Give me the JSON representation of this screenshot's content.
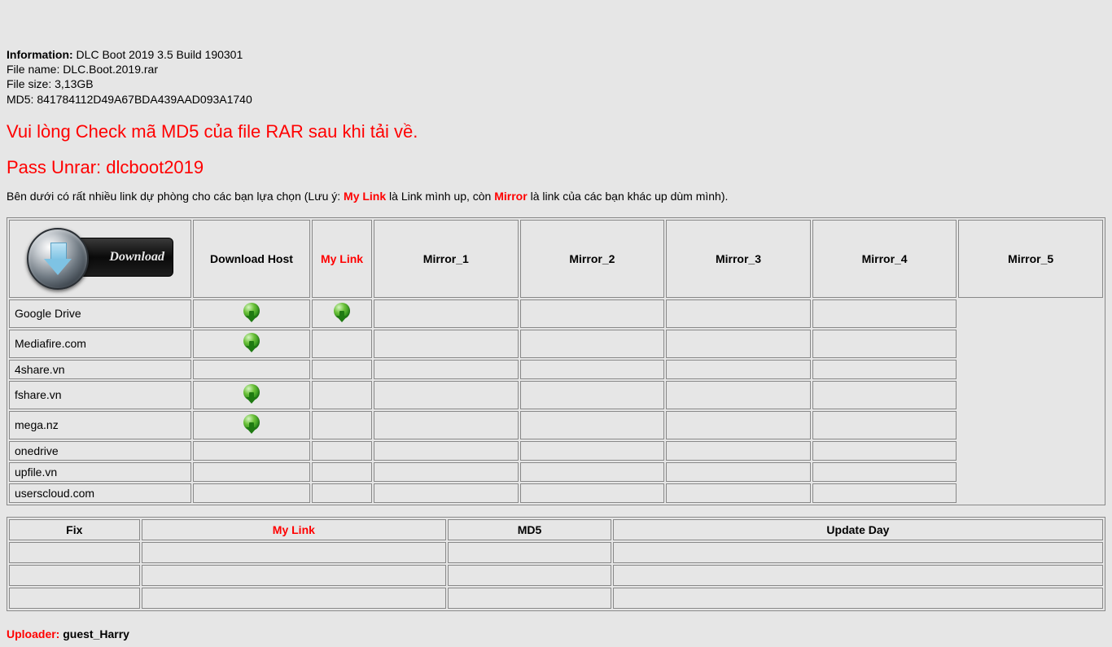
{
  "info": {
    "label": "Information:",
    "title": "DLC Boot 2019 3.5 Build 190301",
    "filename_label": "File name:",
    "filename": "DLC.Boot.2019.rar",
    "filesize_label": "File size:",
    "filesize": "3,13GB",
    "md5_label": "MD5:",
    "md5": "841784112D49A67BDA439AAD093A1740"
  },
  "headings": {
    "check_md5": "Vui lòng Check mã MD5 của file RAR sau khi tải về.",
    "pass_unrar": "Pass Unrar: dlcboot2019"
  },
  "note": {
    "prefix": "Bên dưới có rất nhiều link dự phòng cho các bạn lựa chọn (Lưu ý: ",
    "mylink": "My Link",
    "mid": " là Link mình up, còn ",
    "mirror": "Mirror",
    "suffix": " là link của các bạn khác up dùm mình)."
  },
  "download_badge_text": "Download",
  "table_headers": {
    "download_host": "Download Host",
    "my_link": "My Link",
    "mirror_1": "Mirror_1",
    "mirror_2": "Mirror_2",
    "mirror_3": "Mirror_3",
    "mirror_4": "Mirror_4",
    "mirror_5": "Mirror_5"
  },
  "hosts": [
    {
      "name": "Google Drive",
      "my_link": true,
      "mirror_1": true,
      "mirror_2": false,
      "mirror_3": false,
      "mirror_4": false,
      "mirror_5": false
    },
    {
      "name": "Mediafire.com",
      "my_link": true,
      "mirror_1": false,
      "mirror_2": false,
      "mirror_3": false,
      "mirror_4": false,
      "mirror_5": false
    },
    {
      "name": "4share.vn",
      "my_link": false,
      "mirror_1": false,
      "mirror_2": false,
      "mirror_3": false,
      "mirror_4": false,
      "mirror_5": false
    },
    {
      "name": "fshare.vn",
      "my_link": true,
      "mirror_1": false,
      "mirror_2": false,
      "mirror_3": false,
      "mirror_4": false,
      "mirror_5": false
    },
    {
      "name": "mega.nz",
      "my_link": true,
      "mirror_1": false,
      "mirror_2": false,
      "mirror_3": false,
      "mirror_4": false,
      "mirror_5": false
    },
    {
      "name": "onedrive",
      "my_link": false,
      "mirror_1": false,
      "mirror_2": false,
      "mirror_3": false,
      "mirror_4": false,
      "mirror_5": false
    },
    {
      "name": "upfile.vn",
      "my_link": false,
      "mirror_1": false,
      "mirror_2": false,
      "mirror_3": false,
      "mirror_4": false,
      "mirror_5": false
    },
    {
      "name": "userscloud.com",
      "my_link": false,
      "mirror_1": false,
      "mirror_2": false,
      "mirror_3": false,
      "mirror_4": false,
      "mirror_5": false
    }
  ],
  "fix_table_headers": {
    "fix": "Fix",
    "my_link": "My Link",
    "md5": "MD5",
    "update_day": "Update Day"
  },
  "fix_rows": [
    {
      "fix": "",
      "my_link": "",
      "md5": "",
      "update_day": ""
    },
    {
      "fix": "",
      "my_link": "",
      "md5": "",
      "update_day": ""
    },
    {
      "fix": "",
      "my_link": "",
      "md5": "",
      "update_day": ""
    }
  ],
  "uploader": {
    "label": "Uploader:",
    "name": "guest_Harry"
  }
}
